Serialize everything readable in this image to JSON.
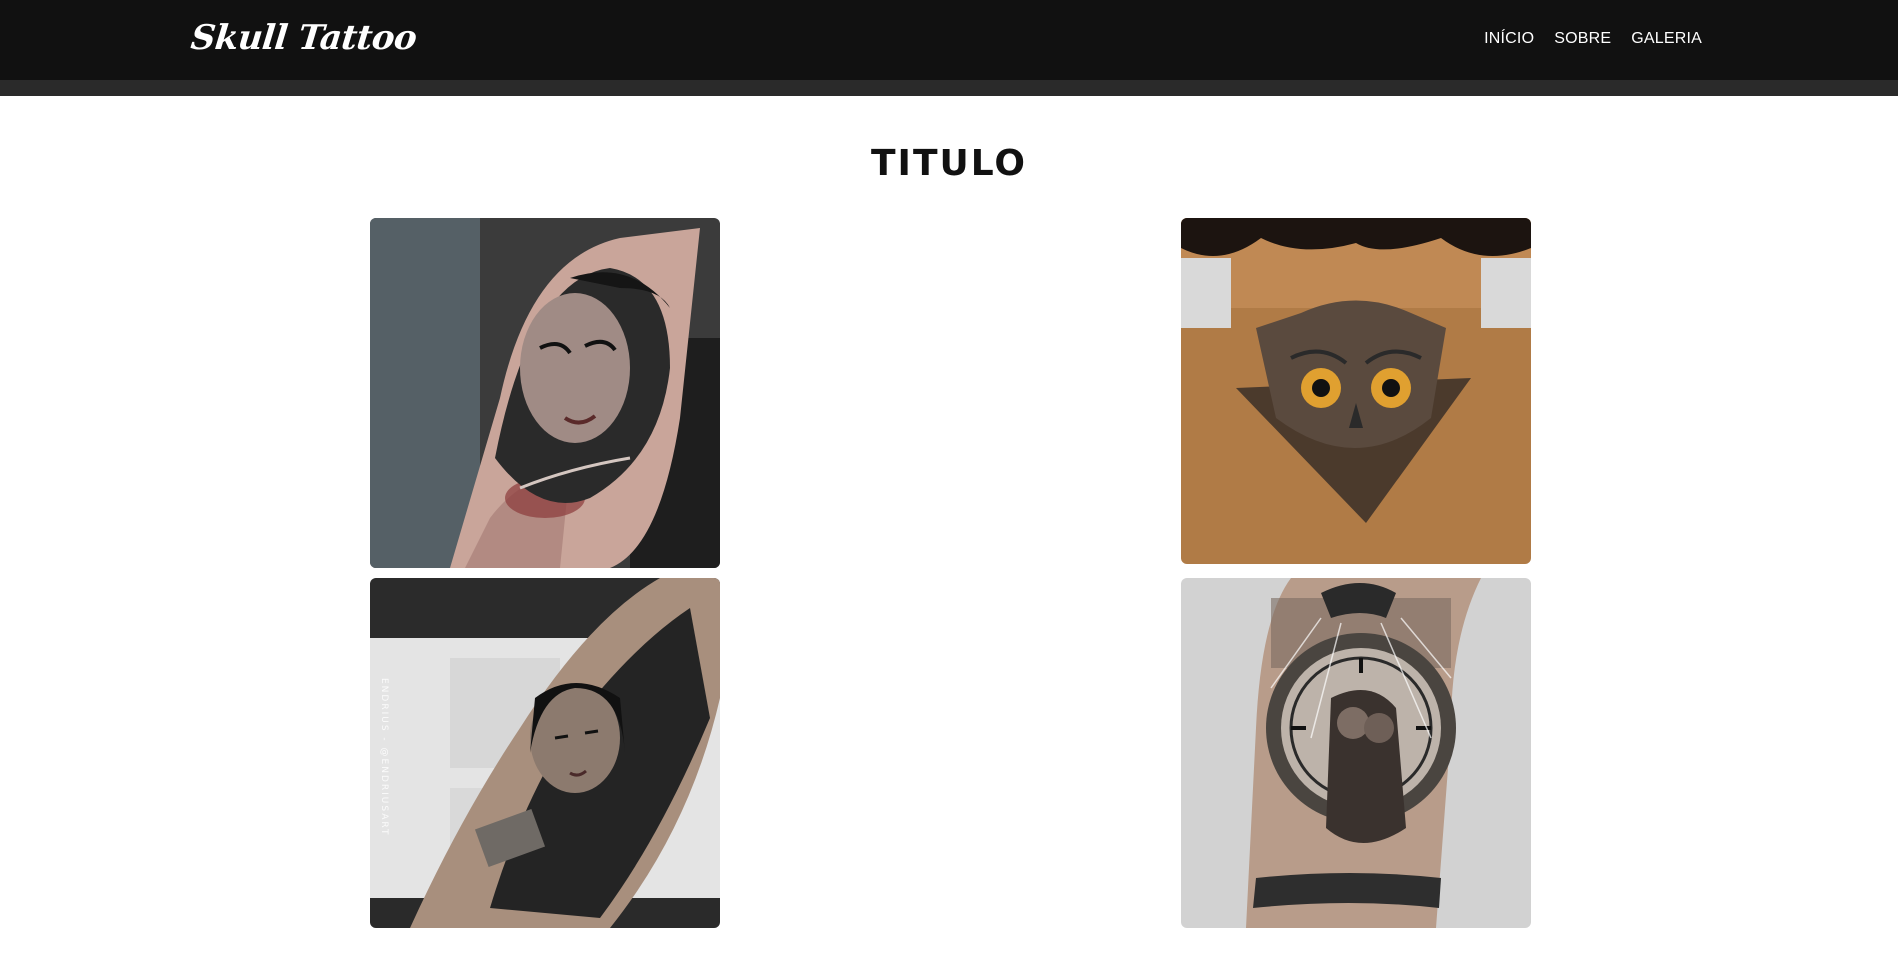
{
  "brand": "Skull Tattoo",
  "nav": {
    "items": [
      "INÍCIO",
      "SOBRE",
      "GALERIA"
    ]
  },
  "gallery": {
    "title": "TITULO",
    "images": [
      {
        "watermark": ""
      },
      {
        "watermark": ""
      },
      {
        "watermark": "ENDRIUS - @ENDRIUSART"
      },
      {
        "watermark": ""
      }
    ]
  }
}
